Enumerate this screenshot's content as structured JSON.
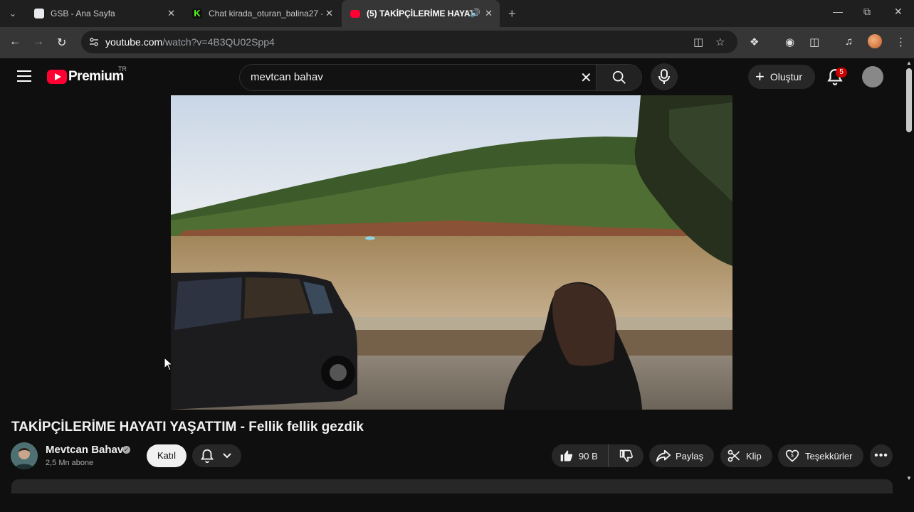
{
  "browser": {
    "tabs": [
      {
        "title": "GSB - Ana Sayfa",
        "favicon_color": "#e8eaed",
        "active": false
      },
      {
        "title": "Chat kirada_oturan_balina27 - \\",
        "favicon_color": "#53fc18",
        "active": false
      },
      {
        "title": "(5) TAKİPÇİLERİME HAYATI Y",
        "favicon_color": "#ff0033",
        "active": true
      }
    ],
    "url_host": "youtube.com",
    "url_path": "/watch?v=4B3QU02Spp4"
  },
  "youtube": {
    "logo_text": "Premium",
    "country_code": "TR",
    "search_value": "mevtcan bahav",
    "create_label": "Oluştur",
    "notification_count": "5"
  },
  "video": {
    "title": "TAKİPÇİLERİME HAYATI YAŞATTIM - Fellik fellik gezdik",
    "channel_name": "Mevtcan Bahav",
    "subscribers": "2,5 Mn abone",
    "join_label": "Katıl",
    "like_count": "90 B",
    "share_label": "Paylaş",
    "clip_label": "Klip",
    "thanks_label": "Teşekkürler"
  },
  "colors": {
    "accent": "#ff0033",
    "background": "#0f0f0f",
    "button_bg": "#272727"
  }
}
